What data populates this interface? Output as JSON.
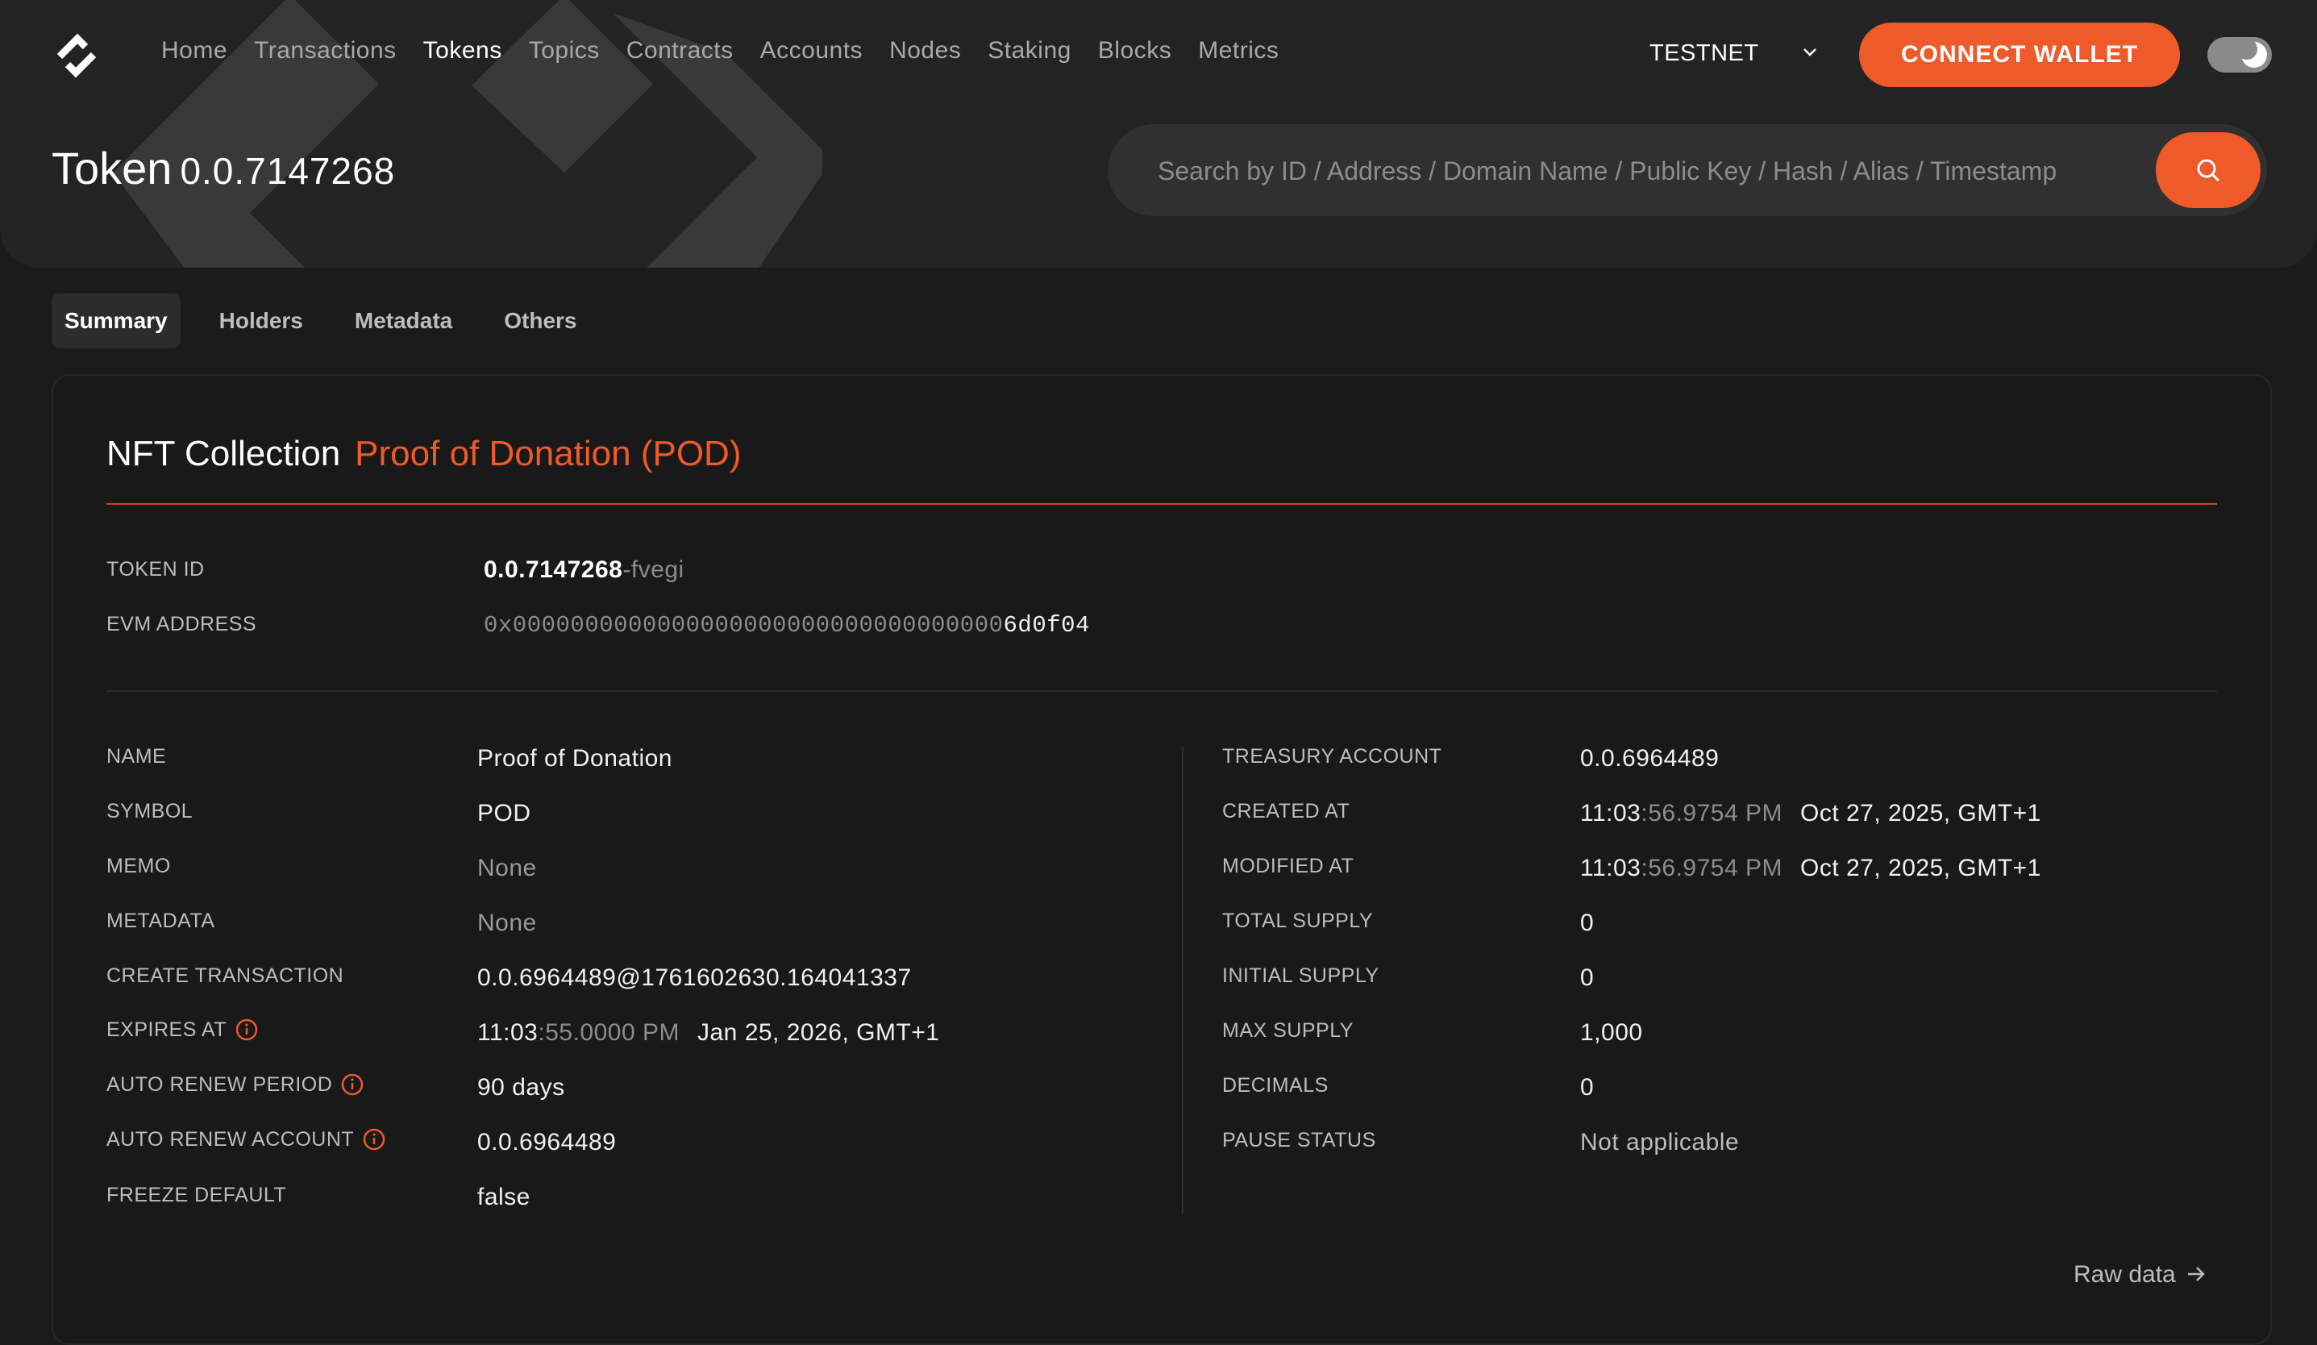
{
  "nav": {
    "items": [
      "Home",
      "Transactions",
      "Tokens",
      "Topics",
      "Contracts",
      "Accounts",
      "Nodes",
      "Staking",
      "Blocks",
      "Metrics"
    ],
    "active": "Tokens",
    "network": "TESTNET",
    "connect_label": "CONNECT WALLET"
  },
  "page": {
    "title": "Token",
    "title_id": "0.0.7147268"
  },
  "search": {
    "placeholder": "Search by ID / Address / Domain Name / Public Key / Hash / Alias / Timestamp"
  },
  "tabs": [
    "Summary",
    "Holders",
    "Metadata",
    "Others"
  ],
  "card": {
    "title": "NFT Collection",
    "collection_name": "Proof of Donation (POD)",
    "token_id": {
      "label": "TOKEN ID",
      "id": "0.0.7147268",
      "checksum": "-fvegi"
    },
    "evm_address": {
      "label": "EVM ADDRESS",
      "prefix": "0x0000000000000000000000000000000000",
      "suffix": "6d0f04"
    },
    "left_fields": [
      {
        "label": "NAME",
        "value": "Proof of Donation"
      },
      {
        "label": "SYMBOL",
        "value": "POD"
      },
      {
        "label": "MEMO",
        "value": "None"
      },
      {
        "label": "METADATA",
        "value": "None"
      },
      {
        "label": "CREATE TRANSACTION",
        "value": "0.0.6964489@1761602630.164041337"
      },
      {
        "label": "EXPIRES AT",
        "time_main": "11:03",
        "time_dim": ":55.0000 PM",
        "date": "Jan 25, 2026, GMT+1"
      },
      {
        "label": "AUTO RENEW PERIOD",
        "value": "90 days"
      },
      {
        "label": "AUTO RENEW ACCOUNT",
        "value": "0.0.6964489"
      },
      {
        "label": "FREEZE DEFAULT",
        "value": "false"
      }
    ],
    "right_fields": [
      {
        "label": "TREASURY ACCOUNT",
        "value": "0.0.6964489"
      },
      {
        "label": "CREATED AT",
        "time_main": "11:03",
        "time_dim": ":56.9754 PM",
        "date": "Oct 27, 2025, GMT+1"
      },
      {
        "label": "MODIFIED AT",
        "time_main": "11:03",
        "time_dim": ":56.9754 PM",
        "date": "Oct 27, 2025, GMT+1"
      },
      {
        "label": "TOTAL SUPPLY",
        "value": "0"
      },
      {
        "label": "INITIAL SUPPLY",
        "value": "0"
      },
      {
        "label": "MAX SUPPLY",
        "value": "1,000"
      },
      {
        "label": "DECIMALS",
        "value": "0"
      },
      {
        "label": "PAUSE STATUS",
        "value": "Not applicable"
      }
    ],
    "raw_data_label": "Raw data"
  },
  "colors": {
    "accent": "#ee5a2a",
    "background": "#1b1b1b",
    "hero": "#232323"
  },
  "icons": [
    "hashscan-logo-icon",
    "chevron-down-icon",
    "theme-toggle-icon",
    "search-icon",
    "info-icon",
    "arrow-right-icon"
  ]
}
